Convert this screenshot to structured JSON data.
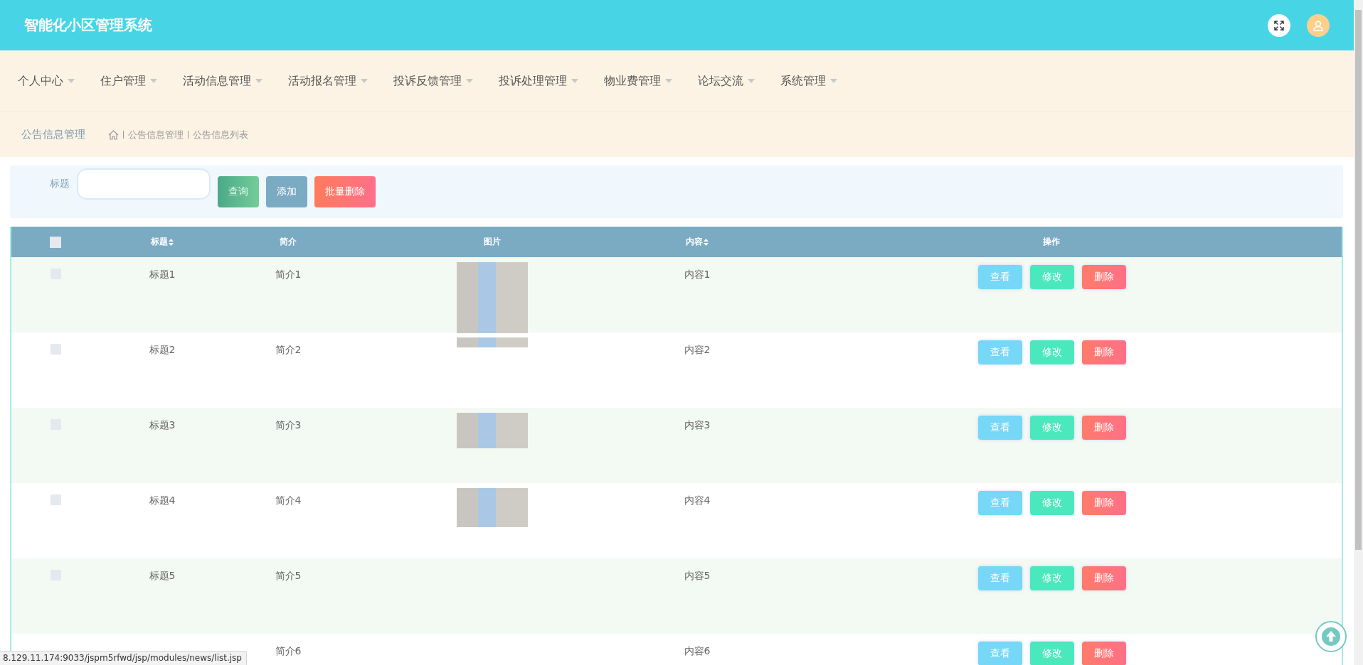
{
  "header": {
    "title": "智能化小区管理系统"
  },
  "nav": [
    {
      "label": "个人中心"
    },
    {
      "label": "住户管理"
    },
    {
      "label": "活动信息管理"
    },
    {
      "label": "活动报名管理"
    },
    {
      "label": "投诉反馈管理"
    },
    {
      "label": "投诉处理管理"
    },
    {
      "label": "物业费管理"
    },
    {
      "label": "论坛交流"
    },
    {
      "label": "系统管理"
    }
  ],
  "breadcrumb": {
    "section": "公告信息管理",
    "path": [
      "公告信息管理",
      "公告信息列表"
    ]
  },
  "search": {
    "label": "标题",
    "buttons": [
      {
        "label": "查询",
        "kind": "search"
      },
      {
        "label": "添加",
        "kind": "add"
      },
      {
        "label": "批量删除",
        "kind": "batch-delete"
      }
    ]
  },
  "table": {
    "all_checked": false,
    "columns": [
      {
        "label": "标题",
        "sortable": true
      },
      {
        "label": "简介",
        "sortable": false
      },
      {
        "label": "图片",
        "sortable": false
      },
      {
        "label": "内容",
        "sortable": true
      },
      {
        "label": "操作",
        "sortable": false
      }
    ],
    "rows": [
      {
        "checked": false,
        "title": "标题1",
        "summary": "简介1",
        "photo": {
          "kind": "full"
        },
        "content": "内容1",
        "actions": [
          {
            "label": "查看",
            "kind": "view"
          },
          {
            "label": "修改",
            "kind": "edit"
          },
          {
            "label": "删除",
            "kind": "delete"
          }
        ]
      },
      {
        "checked": false,
        "title": "标题2",
        "summary": "简介2",
        "photo": {
          "kind": "strip"
        },
        "content": "内容2",
        "actions": [
          {
            "label": "查看",
            "kind": "view"
          },
          {
            "label": "修改",
            "kind": "edit"
          },
          {
            "label": "删除",
            "kind": "delete"
          }
        ]
      },
      {
        "checked": false,
        "title": "标题3",
        "summary": "简介3",
        "photo": {
          "kind": "half"
        },
        "content": "内容3",
        "actions": [
          {
            "label": "查看",
            "kind": "view"
          },
          {
            "label": "修改",
            "kind": "edit"
          },
          {
            "label": "删除",
            "kind": "delete"
          }
        ]
      },
      {
        "checked": false,
        "title": "标题4",
        "summary": "简介4",
        "photo": {
          "kind": "wide"
        },
        "content": "内容4",
        "actions": [
          {
            "label": "查看",
            "kind": "view"
          },
          {
            "label": "修改",
            "kind": "edit"
          },
          {
            "label": "删除",
            "kind": "delete"
          }
        ]
      },
      {
        "checked": false,
        "title": "标题5",
        "summary": "简介5",
        "content": "内容5",
        "actions": [
          {
            "label": "查看",
            "kind": "view"
          },
          {
            "label": "修改",
            "kind": "edit"
          },
          {
            "label": "删除",
            "kind": "delete"
          }
        ]
      },
      {
        "summary": "简介6",
        "content": "内容6",
        "actions": [
          {
            "label": "查看",
            "kind": "view"
          },
          {
            "label": "修改",
            "kind": "edit"
          },
          {
            "label": "删除",
            "kind": "delete"
          }
        ]
      }
    ]
  },
  "status_url": "8.129.11.174:9033/jspm5rfwd/jsp/modules/news/list.jsp"
}
